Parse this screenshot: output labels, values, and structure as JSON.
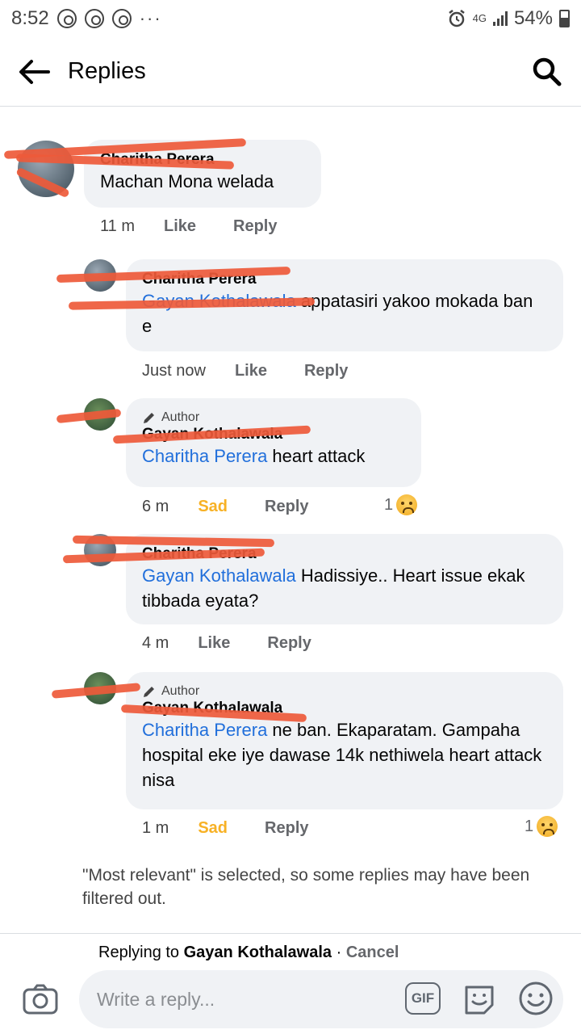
{
  "status_bar": {
    "time": "8:52",
    "more": "···",
    "network": "4G",
    "battery": "54%"
  },
  "header": {
    "title": "Replies"
  },
  "comments": [
    {
      "name": "Charitha Perera",
      "text": "Machan Mona welada",
      "time": "11 m",
      "like": "Like",
      "reply": "Reply"
    },
    {
      "name": "Charitha Perera",
      "mention": "Gayan Kothalawala",
      "text": " appatasiri yakoo mokada ban e",
      "time": "Just now",
      "like": "Like",
      "reply": "Reply"
    },
    {
      "author_tag": "Author",
      "name": "Gayan Kothalawala",
      "mention": "Charitha Perera",
      "text": "  heart attack",
      "time": "6 m",
      "reaction_label": "Sad",
      "reply": "Reply",
      "reaction_count": "1"
    },
    {
      "name": "Charitha Perera",
      "mention": "Gayan Kothalawala",
      "text": " Hadissiye.. Heart issue ekak tibbada eyata?",
      "time": "4 m",
      "like": "Like",
      "reply": "Reply"
    },
    {
      "author_tag": "Author",
      "name": "Gayan Kothalawala",
      "mention": "Charitha Perera",
      "text": " ne ban. Ekaparatam. Gampaha hospital eke iye dawase 14k nethiwela heart attack nisa",
      "time": "1 m",
      "reaction_label": "Sad",
      "reply": "Reply",
      "reaction_count": "1"
    }
  ],
  "notice": "\"Most relevant\" is selected, so some replies may have been filtered out.",
  "composer": {
    "replying_prefix": "Replying to ",
    "replying_name": "Gayan Kothalawala",
    "separator": " · ",
    "cancel": "Cancel",
    "placeholder": "Write a reply...",
    "gif": "GIF"
  }
}
